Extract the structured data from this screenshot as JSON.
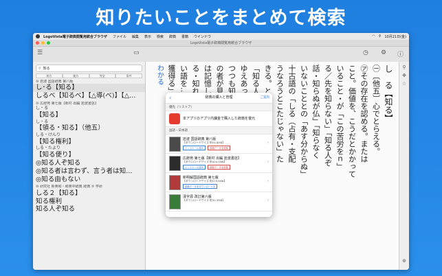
{
  "headline": "知りたいことをまとめて検索",
  "menubar": {
    "app": "LogoVista電子辞典閲覧用統合ブラウザ",
    "items": [
      "ファイル",
      "編集",
      "表示",
      "検索",
      "辞典",
      "書籍",
      "ウインドウ"
    ],
    "date": "10月21日(金)"
  },
  "window": {
    "title": "LogoVista電子辞典閲覧用統合ブラウザ"
  },
  "search": {
    "value": "知る"
  },
  "tabs": [
    "前方",
    "後方",
    "完全",
    "条件"
  ],
  "results": [
    {
      "text": "⑩ 岩波 国語辞典 第八版",
      "style": "small"
    },
    {
      "text": "し･る【知る】",
      "style": "big",
      "hl": true
    },
    {
      "text": "しるべ【知るべ】【△導(べ)】【△…",
      "style": "big"
    },
    {
      "text": "⑩ 広辞苑 第七版【新村 出編 岩波書店】",
      "style": "small"
    },
    {
      "text": "し・る",
      "style": "mid"
    },
    {
      "text": "【知る】",
      "style": "big"
    },
    {
      "text": "し・る",
      "style": "mid"
    },
    {
      "text": "【領る・知る】（他五）",
      "style": "big"
    },
    {
      "text": "しる・けんり",
      "style": "mid"
    },
    {
      "text": "【知る権利】",
      "style": "big"
    },
    {
      "text": "しる・たより",
      "style": "mid"
    },
    {
      "text": "【知る便り】",
      "style": "big"
    },
    {
      "text": "◎知る人ぞ知る",
      "style": "big"
    },
    {
      "text": "◎知る者は言わず、言う者は知…",
      "style": "big"
    },
    {
      "text": "◎知る由もない",
      "style": "big"
    },
    {
      "text": "⑩ 研究社 新英和・和英中辞典 辞典 ⑤ 学研",
      "style": "small"
    },
    {
      "text": "しる２【知る】",
      "style": "big"
    },
    {
      "text": "知る権利",
      "style": "big"
    },
    {
      "text": "知る人ぞ知る",
      "style": "big"
    }
  ],
  "reader_columns": [
    "し　る【知る】",
    "㊀〔他五〕心でとらえる。",
    "㋐その存在を認める。または",
    "こと。価値を、こうだとかかって",
    "いること・が「この苦労をｎ」",
    "る／先を知らない」「知る人ぞ",
    "話・知らぬが仏」「知らなく",
    "いないこととの「あす分からぬ」",
    "十古語の「しる（占有・支配",
    "うなろうとこたじゃない」た",
    "きる。とにかく考えに入れる",
    "「知る人」「友人が知る」",
    "ゆえあって、自分が関知しないこと",
    "つつも知られた、決めれた",
    "の者が見ている所の「知る」",
    "は記憶している。ることは関",
    "る・知れる」ことから「知る",
    "い語を…　「首を…　「妾",
    "獲得る」",
    "わかる"
  ],
  "popup": {
    "title": "辞典の購入と管理",
    "action": "ご案内",
    "section1": "優先（リストア）",
    "store_text": "本アプリのアプリ内課金で購入した辞典を復元",
    "section2": "国語・日本語",
    "items": [
      {
        "name": "岩波 国語辞典 第八版",
        "sub": "【ダウンロードサイズ 約54.8MB】",
        "badge": "インストール済み",
        "badge2": "辞典データを削除",
        "cover": "#4a4a4a"
      },
      {
        "name": "広辞苑 第七版【新村 出編 岩波書店】",
        "sub": "【ダウンロードサイズ 約404.5MB】",
        "badge": "インストール済み",
        "badge2": "辞典データを削除",
        "cover": "#2c2c2c"
      },
      {
        "name": "新明解国語辞典 第七版",
        "sub": "【ダウンロードサイズ 約579.6MB】",
        "badge": "辞典データをダウンロード中",
        "badge2": "",
        "cover": "#b33a3a"
      },
      {
        "name": "漢字源 改訂第六版",
        "sub": "【ダウンロードサイズ 約30.3MB】",
        "badge": "",
        "badge2": "",
        "cover": "#3a7d3a"
      }
    ]
  }
}
